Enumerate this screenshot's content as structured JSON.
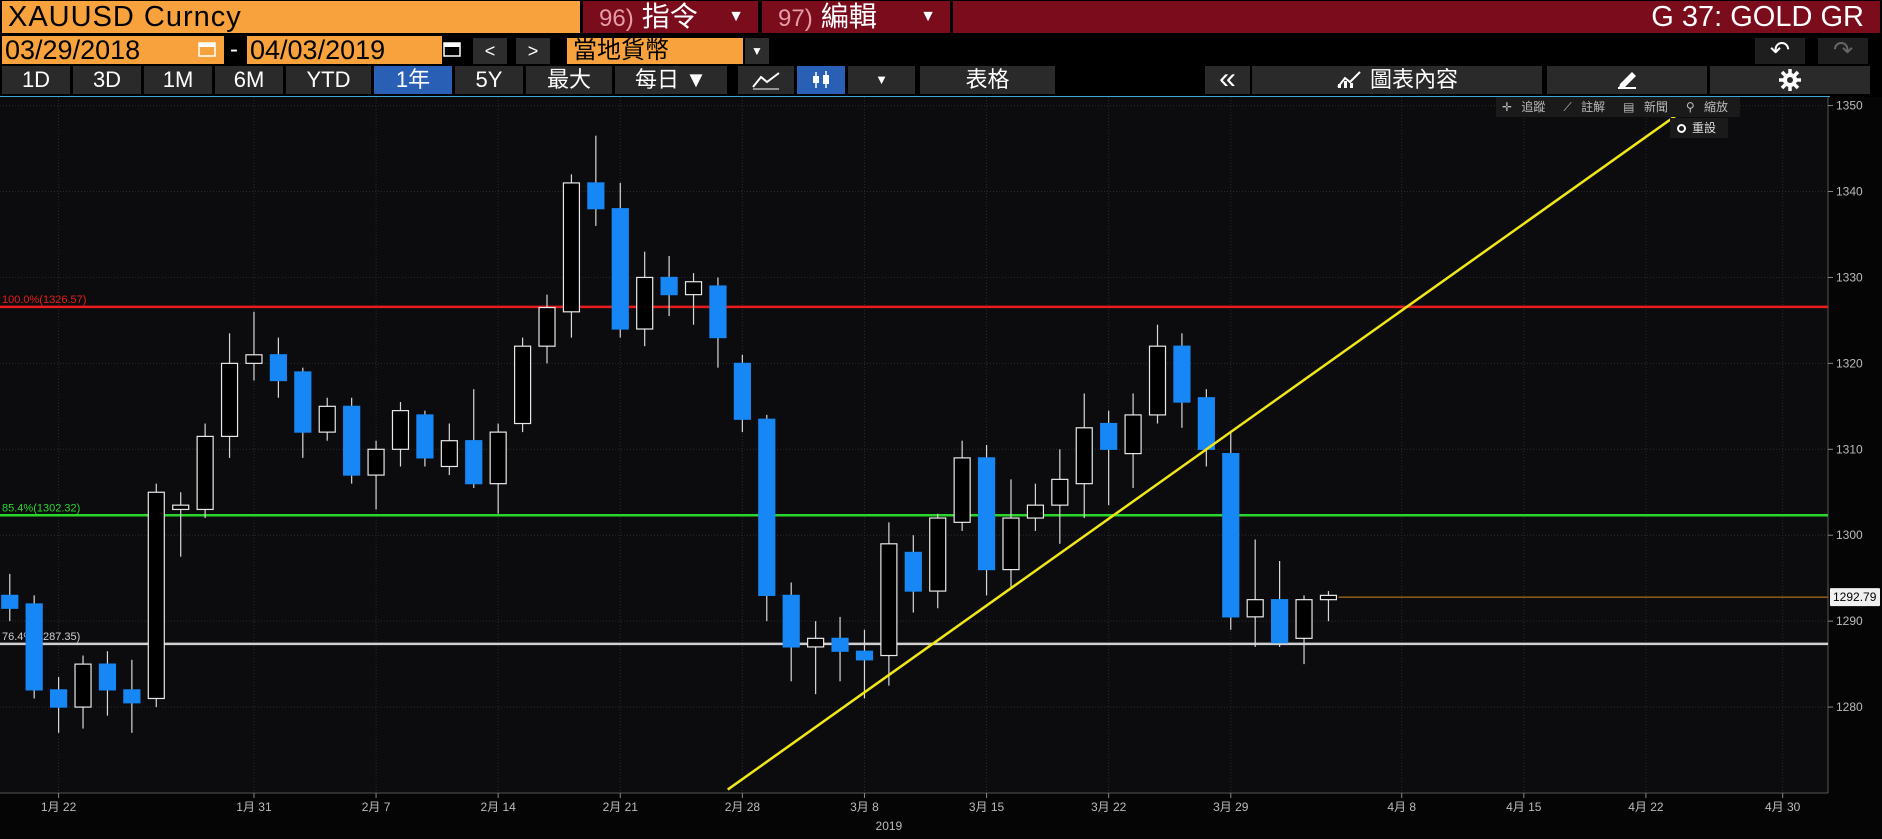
{
  "header": {
    "ticker": "XAUUSD Curncy",
    "cmd1_num": "96)",
    "cmd1_label": "指令",
    "cmd2_num": "97)",
    "cmd2_label": "編輯",
    "title": "G 37: GOLD GR"
  },
  "toolbar2": {
    "start_date": "03/29/2018",
    "dash": "-",
    "end_date": "04/03/2019",
    "prev": "<",
    "next": ">",
    "currency": "當地貨幣"
  },
  "toolbar3": {
    "periods": [
      "1D",
      "3D",
      "1M",
      "6M",
      "YTD",
      "1年",
      "5Y",
      "最大"
    ],
    "active_period": "1年",
    "frequency": "每日 ▼",
    "table_label": "表格",
    "collapse": "«",
    "chart_content": "圖表內容"
  },
  "mini_tools": {
    "track": "追蹤",
    "annotate": "註解",
    "news": "新聞",
    "zoom": "縮放",
    "reset": "重設"
  },
  "colors": {
    "up_fill": "#000000",
    "down_fill": "#1787f5",
    "fib100": "#e81c1c",
    "fib85": "#2bd62b",
    "fib76": "#d0d0d0",
    "trendline": "#f0e816",
    "last_price_line": "#d4861a"
  },
  "chart_data": {
    "type": "candlestick",
    "ylim": [
      1270,
      1351
    ],
    "y_ticks": [
      1280,
      1290,
      1300,
      1310,
      1320,
      1330,
      1340,
      1350
    ],
    "x_ticks": [
      "1月 22",
      "1月 31",
      "2月 7",
      "2月 14",
      "2月 21",
      "2月 28",
      "3月 8",
      "3月 15",
      "3月 22",
      "3月 29",
      "4月 8",
      "4月 15",
      "4月 22",
      "4月 30"
    ],
    "year_label": "2019",
    "last_price": "1292.79",
    "fib_levels": [
      {
        "label": "100.0%(1326.57)",
        "value": 1326.57
      },
      {
        "label": "85.4%(1302.32)",
        "value": 1302.32
      },
      {
        "label": "76.4%(1287.35)",
        "value": 1287.35
      }
    ],
    "trendline": {
      "start": {
        "day": 29.8,
        "value": 1270.4
      },
      "end": {
        "day": 69.6,
        "value": 1350.8
      }
    },
    "candles": [
      {
        "d": 0.4,
        "o": 1293.0,
        "h": 1295.5,
        "l": 1290.0,
        "c": 1291.5
      },
      {
        "d": 1.4,
        "o": 1292.0,
        "h": 1293.0,
        "l": 1281.0,
        "c": 1282.0
      },
      {
        "d": 2.4,
        "o": 1282.0,
        "h": 1283.5,
        "l": 1277.0,
        "c": 1280.0
      },
      {
        "d": 3.4,
        "o": 1280.0,
        "h": 1286.0,
        "l": 1277.5,
        "c": 1285.0
      },
      {
        "d": 4.4,
        "o": 1285.0,
        "h": 1286.5,
        "l": 1279.0,
        "c": 1282.0
      },
      {
        "d": 5.4,
        "o": 1282.0,
        "h": 1285.5,
        "l": 1277.0,
        "c": 1280.5
      },
      {
        "d": 6.4,
        "o": 1281.0,
        "h": 1306.0,
        "l": 1280.0,
        "c": 1305.0
      },
      {
        "d": 7.4,
        "o": 1303.0,
        "h": 1305.0,
        "l": 1297.5,
        "c": 1303.5
      },
      {
        "d": 8.4,
        "o": 1303.0,
        "h": 1313.0,
        "l": 1302.0,
        "c": 1311.5
      },
      {
        "d": 9.4,
        "o": 1311.5,
        "h": 1323.5,
        "l": 1309.0,
        "c": 1320.0
      },
      {
        "d": 10.4,
        "o": 1320.0,
        "h": 1326.0,
        "l": 1318.0,
        "c": 1321.0
      },
      {
        "d": 11.4,
        "o": 1321.0,
        "h": 1323.0,
        "l": 1316.0,
        "c": 1318.0
      },
      {
        "d": 12.4,
        "o": 1319.0,
        "h": 1319.5,
        "l": 1309.0,
        "c": 1312.0
      },
      {
        "d": 13.4,
        "o": 1312.0,
        "h": 1316.0,
        "l": 1311.0,
        "c": 1315.0
      },
      {
        "d": 14.4,
        "o": 1315.0,
        "h": 1316.0,
        "l": 1306.0,
        "c": 1307.0
      },
      {
        "d": 15.4,
        "o": 1307.0,
        "h": 1311.0,
        "l": 1303.0,
        "c": 1310.0
      },
      {
        "d": 16.4,
        "o": 1310.0,
        "h": 1315.5,
        "l": 1308.0,
        "c": 1314.5
      },
      {
        "d": 17.4,
        "o": 1314.0,
        "h": 1314.5,
        "l": 1308.0,
        "c": 1309.0
      },
      {
        "d": 18.4,
        "o": 1308.0,
        "h": 1313.0,
        "l": 1307.0,
        "c": 1311.0
      },
      {
        "d": 19.4,
        "o": 1311.0,
        "h": 1317.0,
        "l": 1305.5,
        "c": 1306.0
      },
      {
        "d": 20.4,
        "o": 1306.0,
        "h": 1313.0,
        "l": 1302.5,
        "c": 1312.0
      },
      {
        "d": 21.4,
        "o": 1313.0,
        "h": 1323.0,
        "l": 1312.0,
        "c": 1322.0
      },
      {
        "d": 22.4,
        "o": 1322.0,
        "h": 1328.0,
        "l": 1320.0,
        "c": 1326.5
      },
      {
        "d": 23.4,
        "o": 1326.0,
        "h": 1342.0,
        "l": 1323.0,
        "c": 1341.0
      },
      {
        "d": 24.4,
        "o": 1341.0,
        "h": 1346.5,
        "l": 1336.0,
        "c": 1338.0
      },
      {
        "d": 25.4,
        "o": 1338.0,
        "h": 1341.0,
        "l": 1323.0,
        "c": 1324.0
      },
      {
        "d": 26.4,
        "o": 1324.0,
        "h": 1333.0,
        "l": 1322.0,
        "c": 1330.0
      },
      {
        "d": 27.4,
        "o": 1330.0,
        "h": 1332.5,
        "l": 1325.5,
        "c": 1328.0
      },
      {
        "d": 28.4,
        "o": 1328.0,
        "h": 1330.5,
        "l": 1324.5,
        "c": 1329.5
      },
      {
        "d": 29.4,
        "o": 1329.0,
        "h": 1330.0,
        "l": 1319.5,
        "c": 1323.0
      },
      {
        "d": 30.4,
        "o": 1320.0,
        "h": 1321.0,
        "l": 1312.0,
        "c": 1313.5
      },
      {
        "d": 31.4,
        "o": 1313.5,
        "h": 1314.0,
        "l": 1290.0,
        "c": 1293.0
      },
      {
        "d": 32.4,
        "o": 1293.0,
        "h": 1294.5,
        "l": 1283.0,
        "c": 1287.0
      },
      {
        "d": 33.4,
        "o": 1287.0,
        "h": 1290.0,
        "l": 1281.5,
        "c": 1288.0
      },
      {
        "d": 34.4,
        "o": 1288.0,
        "h": 1290.5,
        "l": 1283.0,
        "c": 1286.5
      },
      {
        "d": 35.4,
        "o": 1286.5,
        "h": 1289.0,
        "l": 1281.0,
        "c": 1285.5
      },
      {
        "d": 36.4,
        "o": 1286.0,
        "h": 1301.5,
        "l": 1282.5,
        "c": 1299.0
      },
      {
        "d": 37.4,
        "o": 1298.0,
        "h": 1300.0,
        "l": 1291.0,
        "c": 1293.5
      },
      {
        "d": 38.4,
        "o": 1293.5,
        "h": 1302.5,
        "l": 1291.5,
        "c": 1302.0
      },
      {
        "d": 39.4,
        "o": 1301.5,
        "h": 1311.0,
        "l": 1300.5,
        "c": 1309.0
      },
      {
        "d": 40.4,
        "o": 1309.0,
        "h": 1310.5,
        "l": 1293.0,
        "c": 1296.0
      },
      {
        "d": 41.4,
        "o": 1296.0,
        "h": 1306.5,
        "l": 1294.0,
        "c": 1302.0
      },
      {
        "d": 42.4,
        "o": 1302.0,
        "h": 1306.0,
        "l": 1300.5,
        "c": 1303.5
      },
      {
        "d": 43.4,
        "o": 1303.5,
        "h": 1310.0,
        "l": 1299.0,
        "c": 1306.5
      },
      {
        "d": 44.4,
        "o": 1306.0,
        "h": 1316.5,
        "l": 1302.0,
        "c": 1312.5
      },
      {
        "d": 45.4,
        "o": 1313.0,
        "h": 1314.5,
        "l": 1303.5,
        "c": 1310.0
      },
      {
        "d": 46.4,
        "o": 1309.5,
        "h": 1316.5,
        "l": 1305.5,
        "c": 1314.0
      },
      {
        "d": 47.4,
        "o": 1314.0,
        "h": 1324.5,
        "l": 1313.0,
        "c": 1322.0
      },
      {
        "d": 48.4,
        "o": 1322.0,
        "h": 1323.5,
        "l": 1312.5,
        "c": 1315.5
      },
      {
        "d": 49.4,
        "o": 1316.0,
        "h": 1317.0,
        "l": 1308.0,
        "c": 1310.0
      },
      {
        "d": 50.4,
        "o": 1309.5,
        "h": 1312.0,
        "l": 1289.0,
        "c": 1290.5
      },
      {
        "d": 51.4,
        "o": 1290.5,
        "h": 1299.5,
        "l": 1287.0,
        "c": 1292.5
      },
      {
        "d": 52.4,
        "o": 1292.5,
        "h": 1297.0,
        "l": 1287.0,
        "c": 1287.5
      },
      {
        "d": 53.4,
        "o": 1288.0,
        "h": 1293.0,
        "l": 1285.0,
        "c": 1292.5
      },
      {
        "d": 54.4,
        "o": 1292.5,
        "h": 1293.5,
        "l": 1290.0,
        "c": 1293.0
      }
    ]
  }
}
